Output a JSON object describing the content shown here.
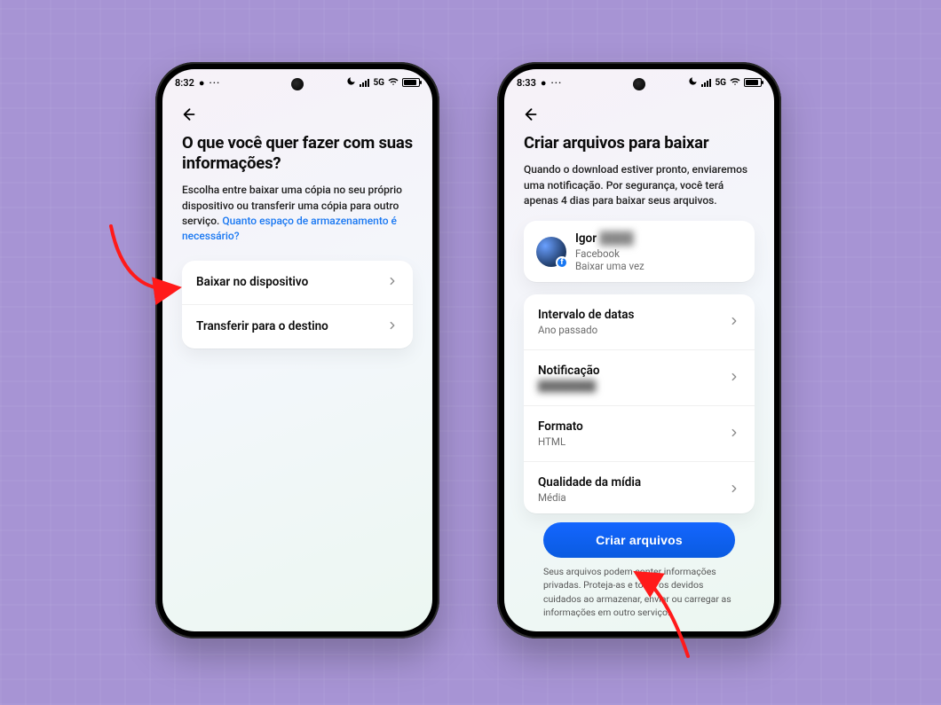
{
  "status": {
    "time_left": "8:32",
    "time_right": "8:33",
    "network_label": "5G"
  },
  "left": {
    "title": "O que você quer fazer com suas informações?",
    "desc_a": "Escolha entre baixar uma cópia no seu próprio dispositivo ou transferir uma cópia para outro serviço. ",
    "desc_link": "Quanto espaço de armazenamento é necessário?",
    "option1": "Baixar no dispositivo",
    "option2": "Transferir para o destino"
  },
  "right": {
    "title": "Criar arquivos para baixar",
    "desc": "Quando o download estiver pronto, enviaremos uma notificação. Por segurança, você terá apenas 4 dias para baixar seus arquivos.",
    "profile_name": "Igor",
    "profile_platform": "Facebook",
    "profile_sub": "Baixar uma vez",
    "date_label": "Intervalo de datas",
    "date_value": "Ano passado",
    "notif_label": "Notificação",
    "notif_value": "████████",
    "format_label": "Formato",
    "format_value": "HTML",
    "media_label": "Qualidade da mídia",
    "media_value": "Média",
    "cta": "Criar arquivos",
    "footer": "Seus arquivos podem conter informações privadas. Proteja-as e tome os devidos cuidados ao armazenar, enviar ou carregar as informações em outro serviço."
  }
}
